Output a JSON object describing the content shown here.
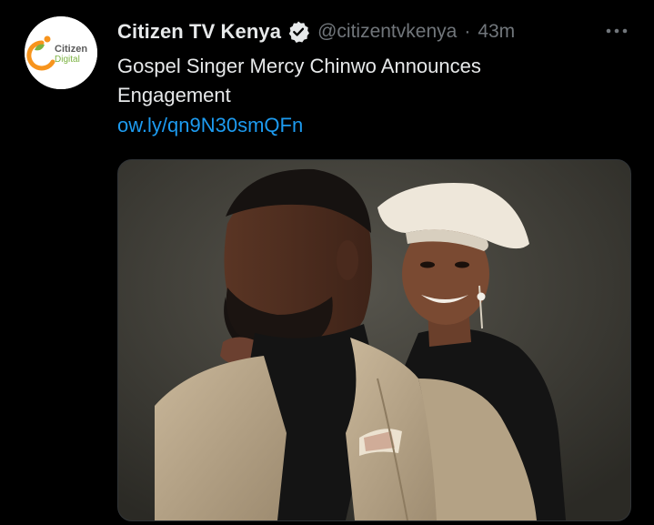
{
  "account": {
    "display_name": "Citizen TV Kenya",
    "handle": "@citizentvkenya",
    "separator": "·",
    "timestamp": "43m",
    "verified": true,
    "avatar_logo_text": [
      "Citizen",
      "Digital"
    ]
  },
  "tweet": {
    "text_lines": [
      "Gospel Singer Mercy Chinwo Announces",
      "Engagement"
    ],
    "link": "ow.ly/qn9N30smQFn"
  },
  "icons": {
    "verified": "verified-badge-icon",
    "more": "more-options-icon"
  },
  "colors": {
    "background": "#000000",
    "primary_text": "#e7e9ea",
    "secondary_text": "#71767b",
    "link": "#1d9bf0",
    "logo_orange": "#f7941d",
    "logo_green": "#7cb342"
  }
}
